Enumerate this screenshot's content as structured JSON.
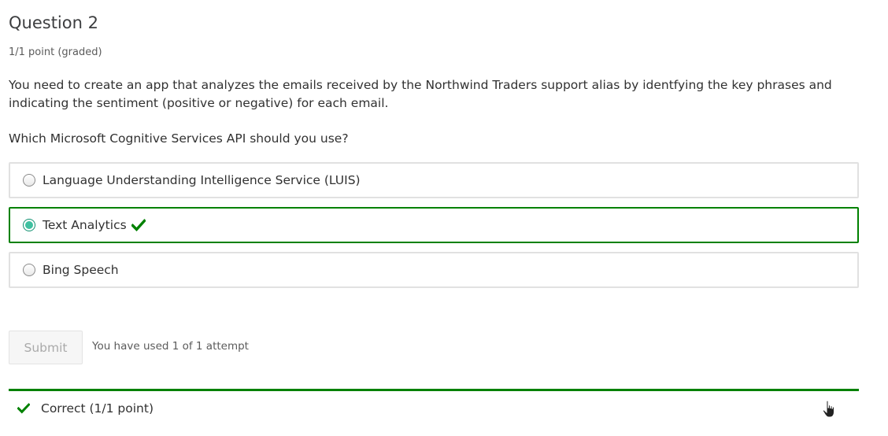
{
  "problem": {
    "title": "Question 2",
    "grade": "1/1 point (graded)",
    "prompt": "You need to create an app that analyzes the emails received by the Northwind Traders support alias by identfying the key phrases and indicating the sentiment (positive or negative) for each email.",
    "question": "Which Microsoft Cognitive Services API should you use?"
  },
  "choices": [
    {
      "label": "Language Understanding Intelligence Service (LUIS)",
      "selected": false,
      "correct": false
    },
    {
      "label": "Text Analytics",
      "selected": true,
      "correct": true
    },
    {
      "label": "Bing Speech",
      "selected": false,
      "correct": false
    }
  ],
  "actions": {
    "submit_label": "Submit",
    "attempts_text": "You have used 1 of 1 attempt"
  },
  "feedback": {
    "status_text": "Correct (1/1 point)",
    "status_icon": "checkmark-icon"
  },
  "colors": {
    "correct": "#008100",
    "radio_selected": "#3fc0a0",
    "choice_border": "#e1e1e1"
  }
}
